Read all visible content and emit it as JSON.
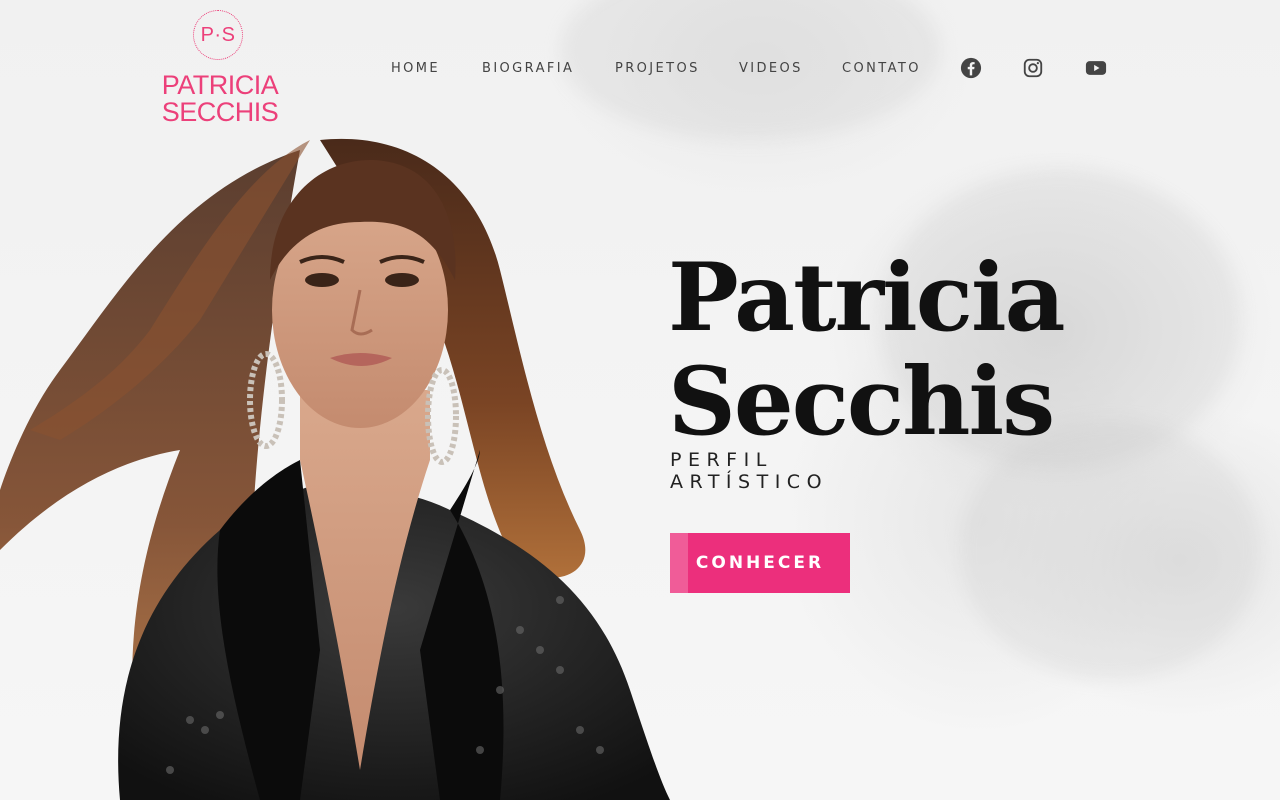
{
  "logo": {
    "monogram": "P·S",
    "line1": "PATRICIA",
    "line2": "SECCHIS"
  },
  "nav": {
    "items": [
      {
        "label": "HOME"
      },
      {
        "label": "BIOGRAFIA"
      },
      {
        "label": "PROJETOS"
      },
      {
        "label": "VIDEOS"
      },
      {
        "label": "CONTATO"
      }
    ]
  },
  "social": {
    "icons": [
      "facebook-icon",
      "instagram-icon",
      "youtube-icon"
    ]
  },
  "hero": {
    "title_line1": "Patricia",
    "title_line2": "Secchis",
    "subtitle_line1": "PERFIL",
    "subtitle_line2": "ARTÍSTICO",
    "cta_label": "CONHECER"
  },
  "colors": {
    "accent": "#ec2f7c",
    "logo": "#ec407a",
    "text": "#111111",
    "nav": "#444444"
  }
}
